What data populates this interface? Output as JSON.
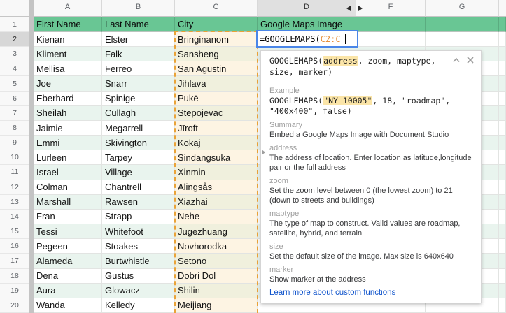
{
  "sheet": {
    "column_letters": [
      "A",
      "B",
      "C",
      "D",
      "F",
      "G"
    ],
    "header_row": {
      "cells": [
        "First Name",
        "Last Name",
        "City",
        "Google Maps Image"
      ]
    },
    "rows": [
      {
        "n": 2,
        "first": "Kienan",
        "last": "Elster",
        "city": "Bringinanom"
      },
      {
        "n": 3,
        "first": "Kliment",
        "last": "Falk",
        "city": "Sansheng"
      },
      {
        "n": 4,
        "first": "Mellisa",
        "last": "Ferreo",
        "city": "San Agustin"
      },
      {
        "n": 5,
        "first": "Joe",
        "last": "Snarr",
        "city": "Jihlava"
      },
      {
        "n": 6,
        "first": "Eberhard",
        "last": "Spinige",
        "city": "Pukë"
      },
      {
        "n": 7,
        "first": "Sheilah",
        "last": "Cullagh",
        "city": "Stepojevac"
      },
      {
        "n": 8,
        "first": "Jaimie",
        "last": "Megarrell",
        "city": "Jīroft"
      },
      {
        "n": 9,
        "first": "Emmi",
        "last": "Skivington",
        "city": "Kokaj"
      },
      {
        "n": 10,
        "first": "Lurleen",
        "last": "Tarpey",
        "city": "Sindangsuka"
      },
      {
        "n": 11,
        "first": "Israel",
        "last": "Village",
        "city": "Xinmin"
      },
      {
        "n": 12,
        "first": "Colman",
        "last": "Chantrell",
        "city": "Alingsås"
      },
      {
        "n": 13,
        "first": "Marshall",
        "last": "Rawsen",
        "city": "Xiazhai"
      },
      {
        "n": 14,
        "first": "Fran",
        "last": "Strapp",
        "city": "Nehe"
      },
      {
        "n": 15,
        "first": "Tessi",
        "last": "Whitefoot",
        "city": "Jugezhuang"
      },
      {
        "n": 16,
        "first": "Pegeen",
        "last": "Stoakes",
        "city": "Novhorodka"
      },
      {
        "n": 17,
        "first": "Alameda",
        "last": "Burtwhistle",
        "city": "Setono"
      },
      {
        "n": 18,
        "first": "Dena",
        "last": "Gustus",
        "city": "Dobri Dol"
      },
      {
        "n": 19,
        "first": "Aura",
        "last": "Glowacz",
        "city": "Shilin"
      },
      {
        "n": 20,
        "first": "Wanda",
        "last": "Kelledy",
        "city": "Meijiang"
      }
    ]
  },
  "editor": {
    "prefix": "=GOOGLEMAPS(",
    "range_ref": "C2:C"
  },
  "tooltip": {
    "signature": {
      "fn": "GOOGLEMAPS(",
      "arg": "address",
      "rest": ", zoom, maptype, size, marker)"
    },
    "example_label": "Example",
    "example": {
      "pre": "GOOGLEMAPS(",
      "highlight": "\"NY 10005\"",
      "post": ", 18, \"roadmap\", \"400x400\", false)"
    },
    "summary_label": "Summary",
    "summary": "Embed a Google Maps Image with Document Studio",
    "params": [
      {
        "name": "address",
        "desc": "The address of location. Enter location as latitude,longitude pair or the full address"
      },
      {
        "name": "zoom",
        "desc": "Set the zoom level between 0 (the lowest zoom) to 21 (down to streets and buildings)"
      },
      {
        "name": "maptype",
        "desc": "The type of map to construct. Valid values are roadmap, satellite, hybrid, and terrain"
      },
      {
        "name": "size",
        "desc": "Set the default size of the image. Max size is 640x640"
      },
      {
        "name": "marker",
        "desc": "Show marker at the address"
      }
    ],
    "link": "Learn more about custom functions"
  },
  "colors": {
    "header_green": "#69c694",
    "band_green": "#e9f4ee",
    "column_c_tint_on_white": "#fdf4e3",
    "column_c_tint_on_green": "#f0f0dd",
    "selection_blue": "#4a86e8",
    "range_dash_orange": "#eaa338",
    "formula_ref_orange": "#e8913c",
    "link_blue": "#1155cc"
  }
}
